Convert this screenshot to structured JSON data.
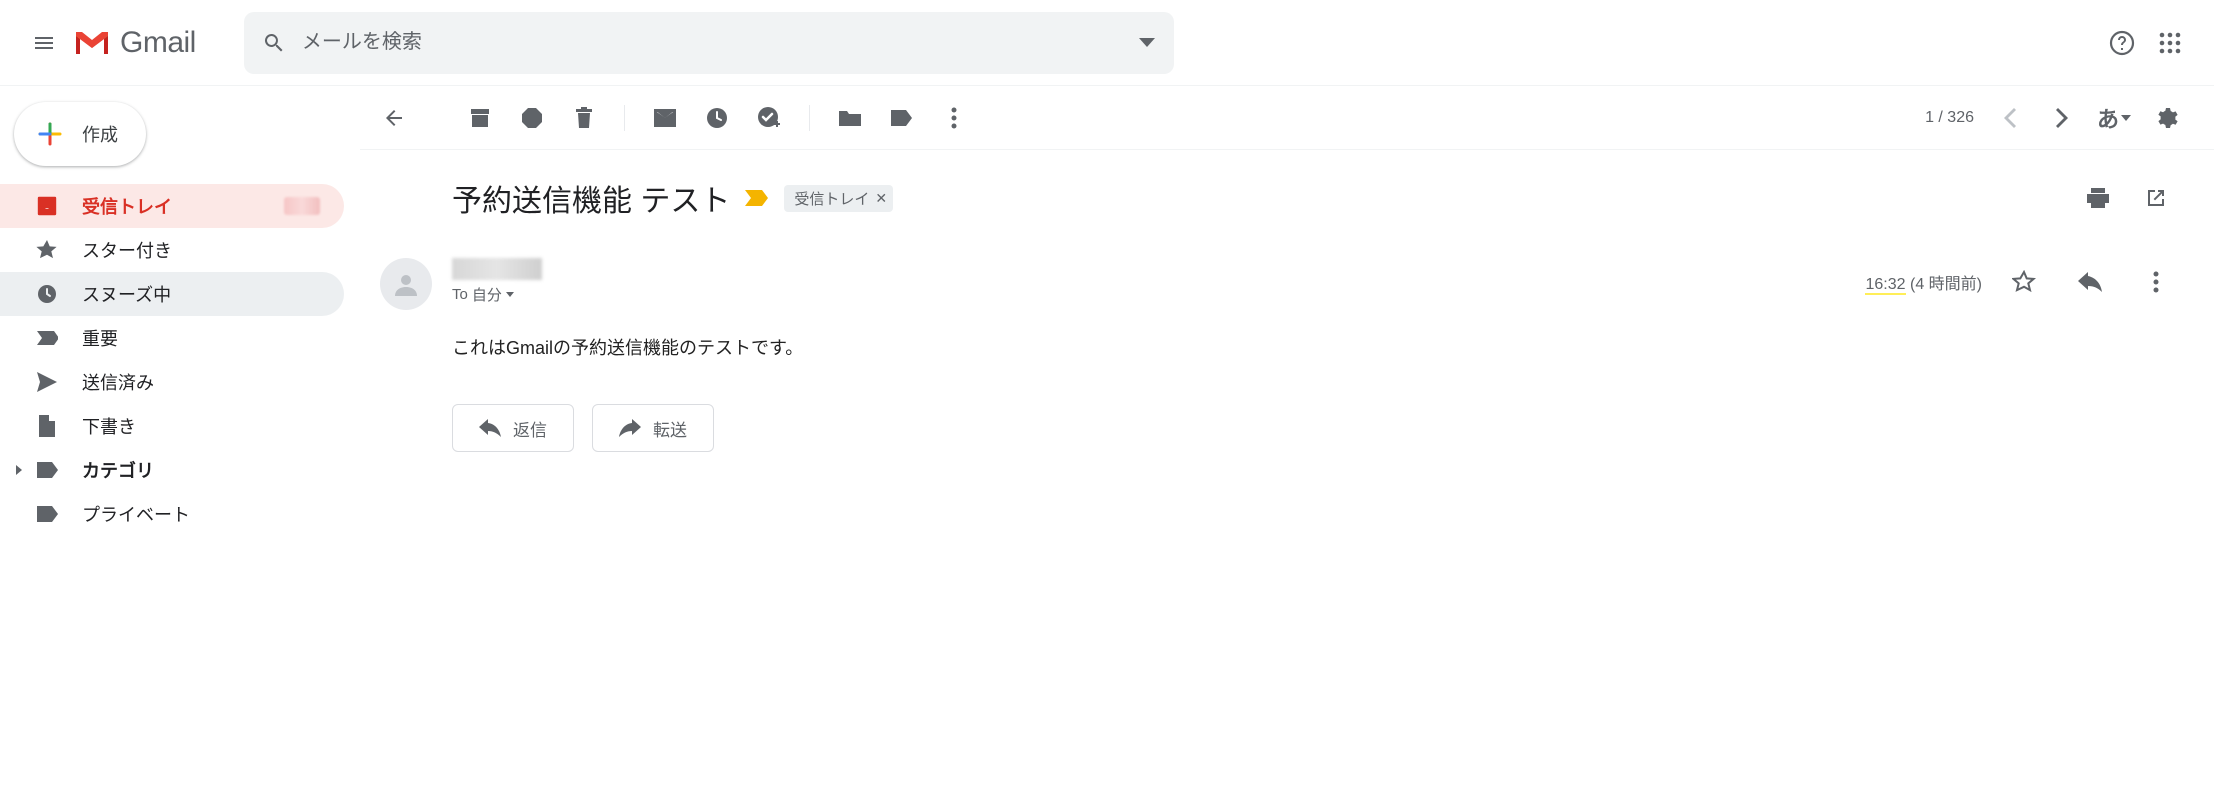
{
  "app_name": "Gmail",
  "search": {
    "placeholder": "メールを検索"
  },
  "compose_label": "作成",
  "sidebar": {
    "items": [
      {
        "label": "受信トレイ"
      },
      {
        "label": "スター付き"
      },
      {
        "label": "スヌーズ中"
      },
      {
        "label": "重要"
      },
      {
        "label": "送信済み"
      },
      {
        "label": "下書き"
      },
      {
        "label": "カテゴリ"
      },
      {
        "label": "プライベート"
      }
    ]
  },
  "toolbar": {
    "pager": "1 / 326",
    "lang": "あ"
  },
  "message": {
    "subject": "予約送信機能 テスト",
    "chip_label": "受信トレイ",
    "to_prefix": "To",
    "to_target": "自分",
    "time": "16:32",
    "time_rel": "(4 時間前)",
    "body": "これはGmailの予約送信機能のテストです。",
    "reply_label": "返信",
    "forward_label": "転送"
  }
}
